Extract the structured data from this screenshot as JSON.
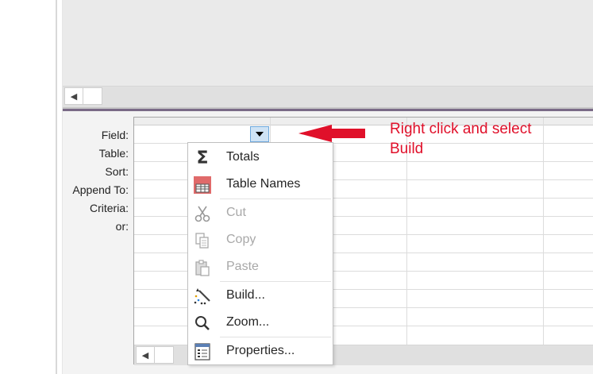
{
  "query_grid": {
    "row_labels": [
      "Field:",
      "Table:",
      "Sort:",
      "Append To:",
      "Criteria:",
      "or:"
    ]
  },
  "annotation": {
    "line1": "Right click and select",
    "line2": "Build",
    "color": "#e0102a"
  },
  "context_menu": {
    "items": [
      {
        "label": "Totals",
        "icon": "sigma-icon",
        "enabled": true
      },
      {
        "label": "Table Names",
        "icon": "table-names-icon",
        "enabled": true
      },
      {
        "label": "Cut",
        "icon": "scissors-icon",
        "enabled": false
      },
      {
        "label": "Copy",
        "icon": "copy-icon",
        "enabled": false
      },
      {
        "label": "Paste",
        "icon": "paste-icon",
        "enabled": false
      },
      {
        "label": "Build...",
        "icon": "build-wand-icon",
        "enabled": true
      },
      {
        "label": "Zoom...",
        "icon": "magnifier-icon",
        "enabled": true
      },
      {
        "label": "Properties...",
        "icon": "properties-sheet-icon",
        "enabled": true
      }
    ]
  },
  "scroll": {
    "left_arrow": "◀"
  }
}
